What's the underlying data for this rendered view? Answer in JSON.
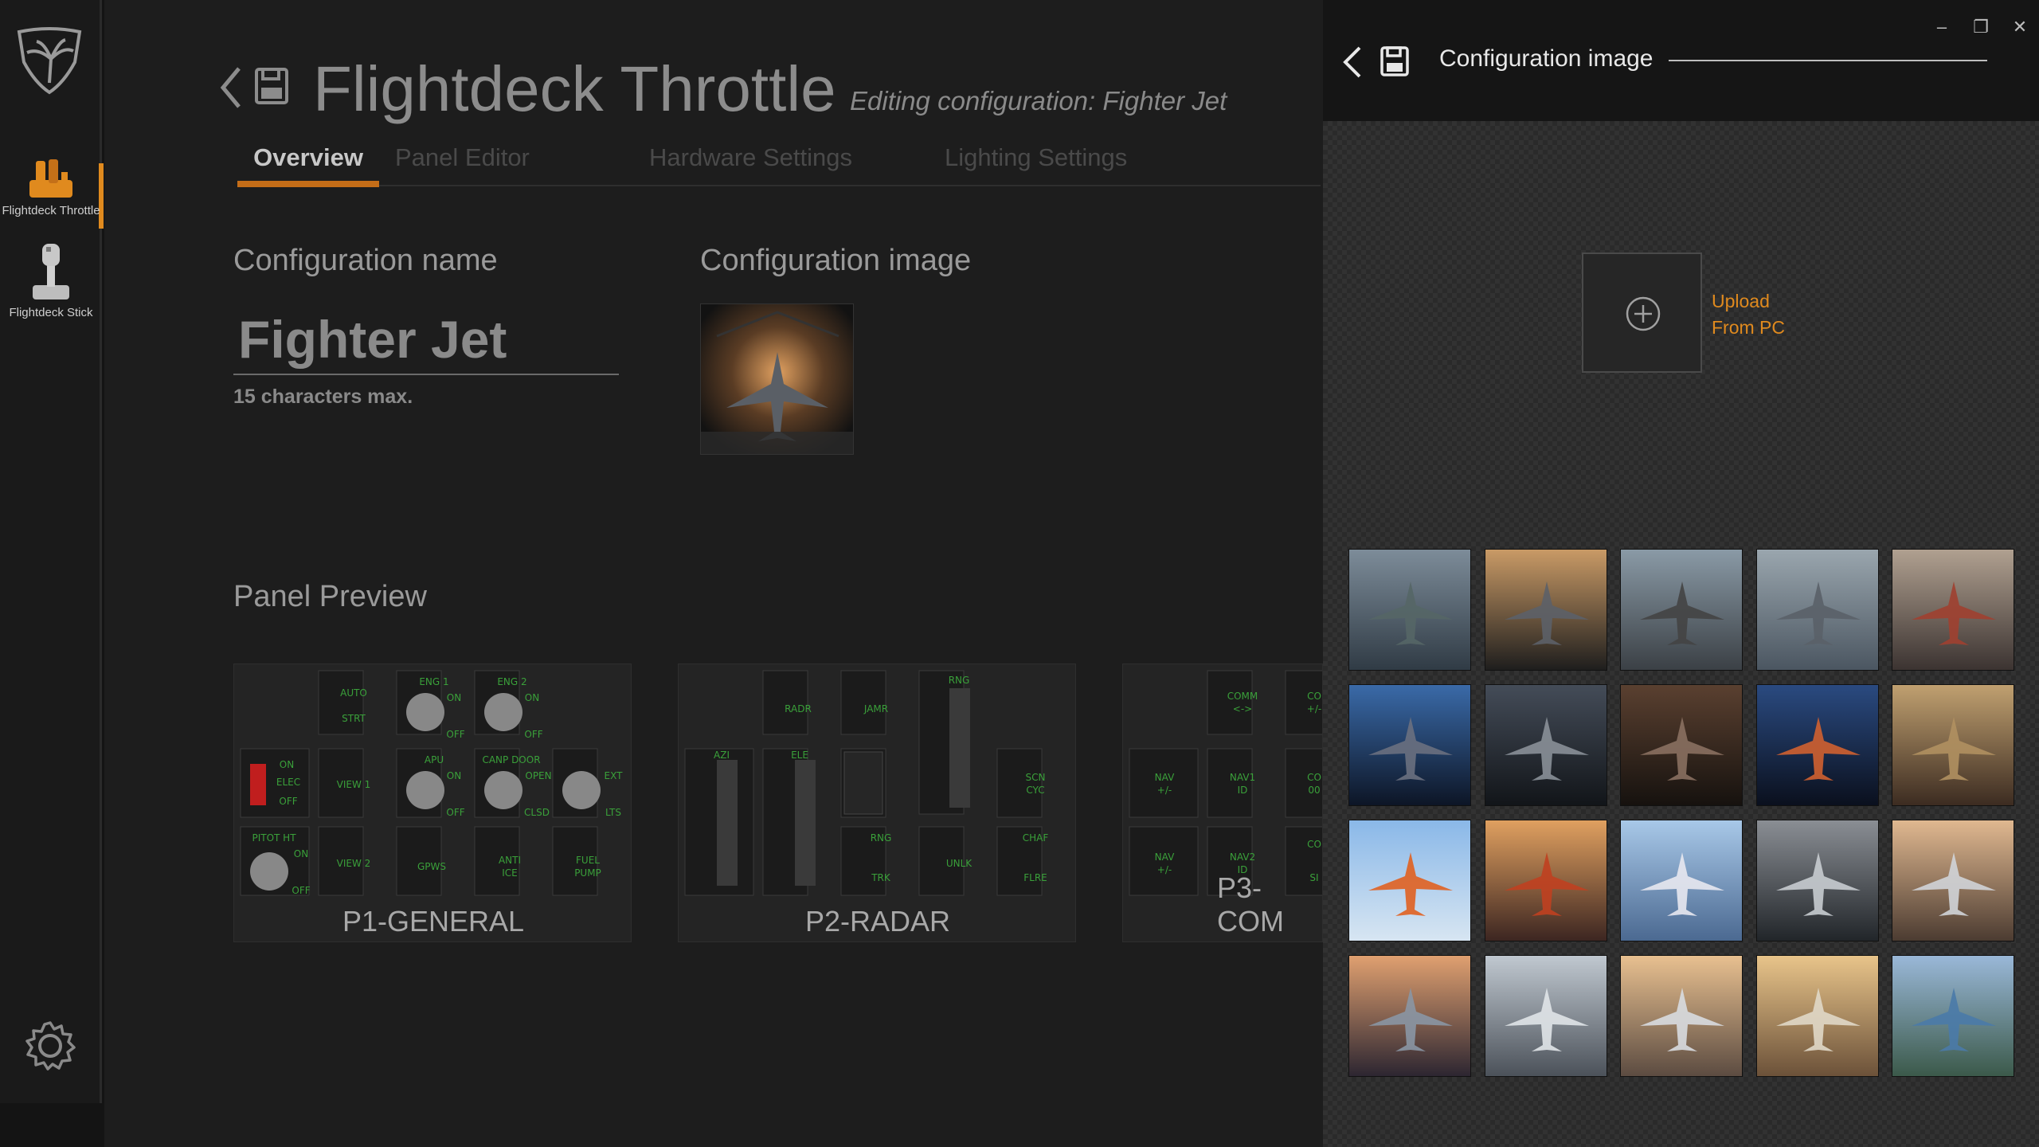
{
  "sidebar": {
    "items": [
      {
        "label": "Flightdeck Throttle",
        "active": true
      },
      {
        "label": "Flightdeck Stick",
        "active": false
      }
    ]
  },
  "header": {
    "title": "Flightdeck Throttle",
    "editing": "Editing configuration: Fighter Jet"
  },
  "tabs": [
    {
      "label": "Overview",
      "active": true
    },
    {
      "label": "Panel Editor",
      "active": false
    },
    {
      "label": "Hardware Settings",
      "active": false
    },
    {
      "label": "Lighting Settings",
      "active": false
    }
  ],
  "config": {
    "name_label": "Configuration name",
    "name_value": "Fighter Jet",
    "name_hint": "15 characters max.",
    "image_label": "Configuration image"
  },
  "panel_preview": {
    "title": "Panel Preview",
    "panels": [
      {
        "label": "P1-GENERAL",
        "controls": [
          "AUTO",
          "STRT",
          "ENG 1",
          "ON",
          "OFF",
          "ENG 2",
          "ON",
          "OFF",
          "ON",
          "ELEC",
          "OFF",
          "VIEW 1",
          "APU",
          "ON",
          "OFF",
          "CANP DOOR",
          "OPEN",
          "CLSD",
          "EXT",
          "LTS",
          "PITOT HT",
          "ON",
          "OFF",
          "VIEW 2",
          "GPWS",
          "ANTI",
          "ICE",
          "FUEL",
          "PUMP"
        ]
      },
      {
        "label": "P2-RADAR",
        "controls": [
          "RADR",
          "JAMR",
          "RNG",
          "AZI",
          "ELE",
          "SCN",
          "CYC",
          "RNG",
          "TRK",
          "UNLK",
          "CHAF",
          "FLRE"
        ]
      },
      {
        "label": "P3-COM",
        "controls": [
          "COMM",
          "<->",
          "CO",
          "+/-",
          "NAV",
          "+/-",
          "NAV1",
          "ID",
          "CO",
          "00",
          "NAV",
          "+/-",
          "NAV2",
          "ID",
          "CO",
          "SI"
        ]
      }
    ]
  },
  "drawer": {
    "title": "Configuration image",
    "upload_label": "Upload\nFrom PC",
    "window_controls": [
      "–",
      "❐",
      "✕"
    ],
    "accent": "#e08a1e",
    "images": [
      {
        "subject": "stealth-fighter"
      },
      {
        "subject": "fighter-hangar"
      },
      {
        "subject": "twin-prop"
      },
      {
        "subject": "attack-jet"
      },
      {
        "subject": "vintage-prop"
      },
      {
        "subject": "spaceship-earth"
      },
      {
        "subject": "starship-grey"
      },
      {
        "subject": "starship-brown"
      },
      {
        "subject": "starship-orange"
      },
      {
        "subject": "starship-gold"
      },
      {
        "subject": "airliner-orange"
      },
      {
        "subject": "airliner-sunset"
      },
      {
        "subject": "airliner-blue"
      },
      {
        "subject": "jet-hangar"
      },
      {
        "subject": "business-jet"
      },
      {
        "subject": "prop-sunset"
      },
      {
        "subject": "business-jet-silver"
      },
      {
        "subject": "jet-clouds"
      },
      {
        "subject": "jet-golden"
      },
      {
        "subject": "jet-mountains"
      }
    ]
  }
}
